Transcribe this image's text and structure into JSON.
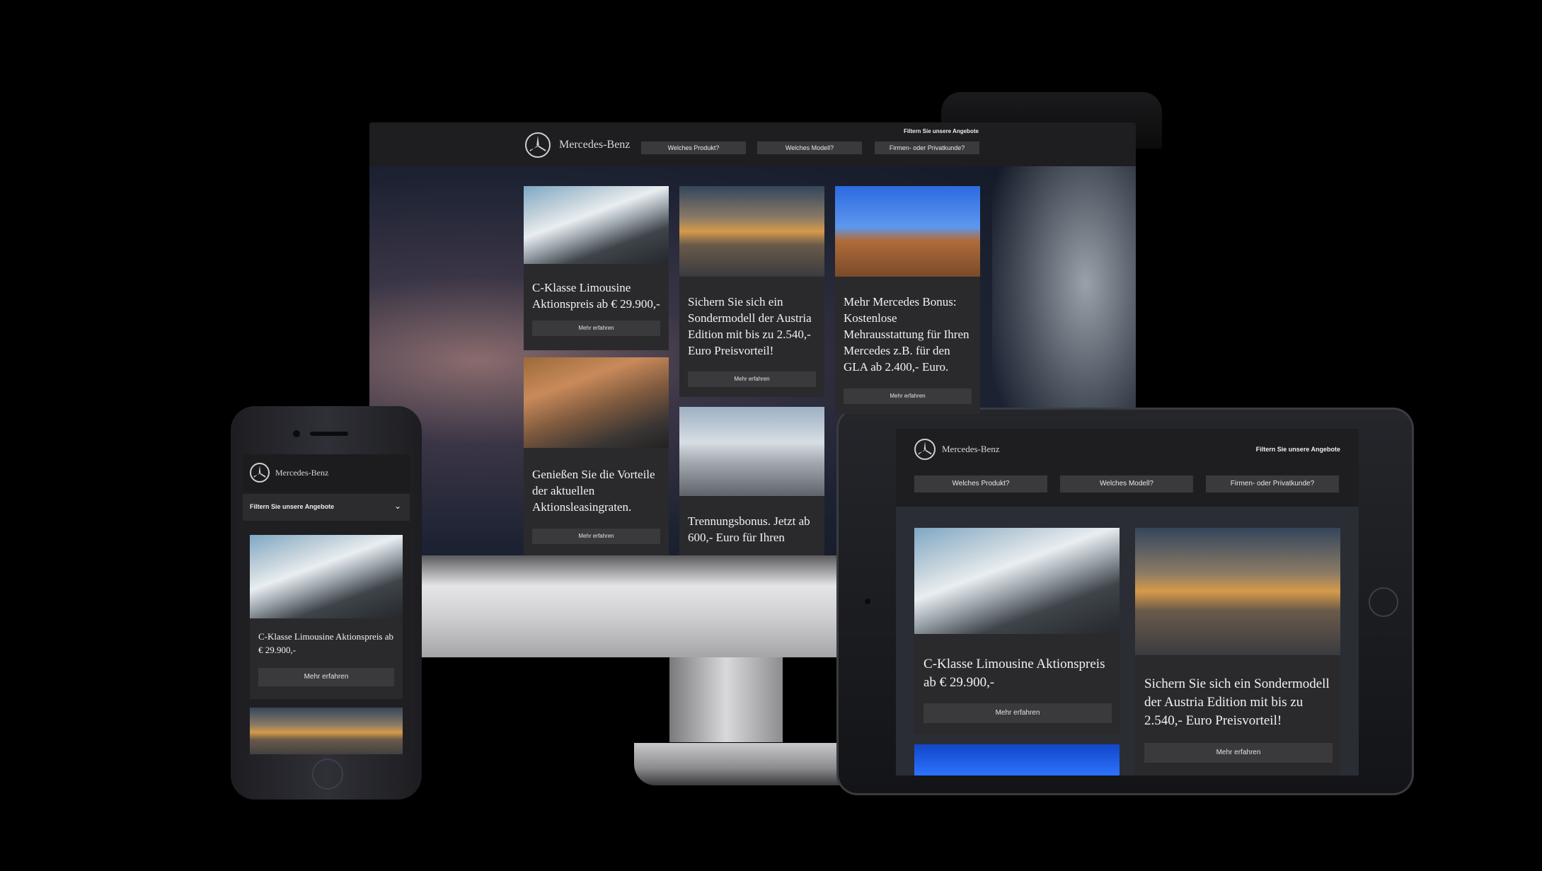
{
  "brand": "Mercedes-Benz",
  "filter_heading": "Filtern Sie unsere Angebote",
  "filters": [
    "Welches Produkt?",
    "Welches Modell?",
    "Firmen- oder Privatkunde?"
  ],
  "cta": "Mehr erfahren",
  "offers": [
    {
      "title": "C-Klasse Limousine Aktionspreis ab € 29.900,-"
    },
    {
      "title": "Sichern Sie sich ein Sondermodell der Austria Edition mit bis zu 2.540,- Euro Preisvorteil!"
    },
    {
      "title": "Mehr Mercedes Bonus: Kostenlose Mehrausstattung für Ihren Mercedes z.B. für den GLA ab 2.400,- Euro."
    },
    {
      "title": "Genießen Sie die Vorteile der aktuellen Aktionsleasingraten."
    },
    {
      "title": "Trennungsbonus. Jetzt ab 600,- Euro für Ihren"
    }
  ],
  "colors": {
    "page_bg": "#000000",
    "card_bg": "#2a2a2c",
    "button_bg": "#3a3a3c",
    "header_bg": "#1e1e20"
  }
}
